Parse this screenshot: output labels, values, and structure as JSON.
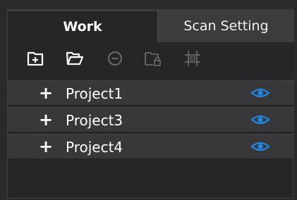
{
  "tabs": {
    "work_label": "Work",
    "scan_label": "Scan Setting"
  },
  "toolbar": {
    "icons": [
      "add-folder-icon",
      "open-folder-icon",
      "remove-icon",
      "locked-folder-icon",
      "crop-icon"
    ]
  },
  "projects": [
    {
      "label": "Project1",
      "expand": "+",
      "visible_icon": "eye-icon"
    },
    {
      "label": "Project3",
      "expand": "+",
      "visible_icon": "eye-icon"
    },
    {
      "label": "Project4",
      "expand": "+",
      "visible_icon": "eye-icon"
    }
  ],
  "colors": {
    "eye": "#1e88e5",
    "disabled_icon": "#6a6a6e",
    "enabled_icon": "#ffffff"
  }
}
